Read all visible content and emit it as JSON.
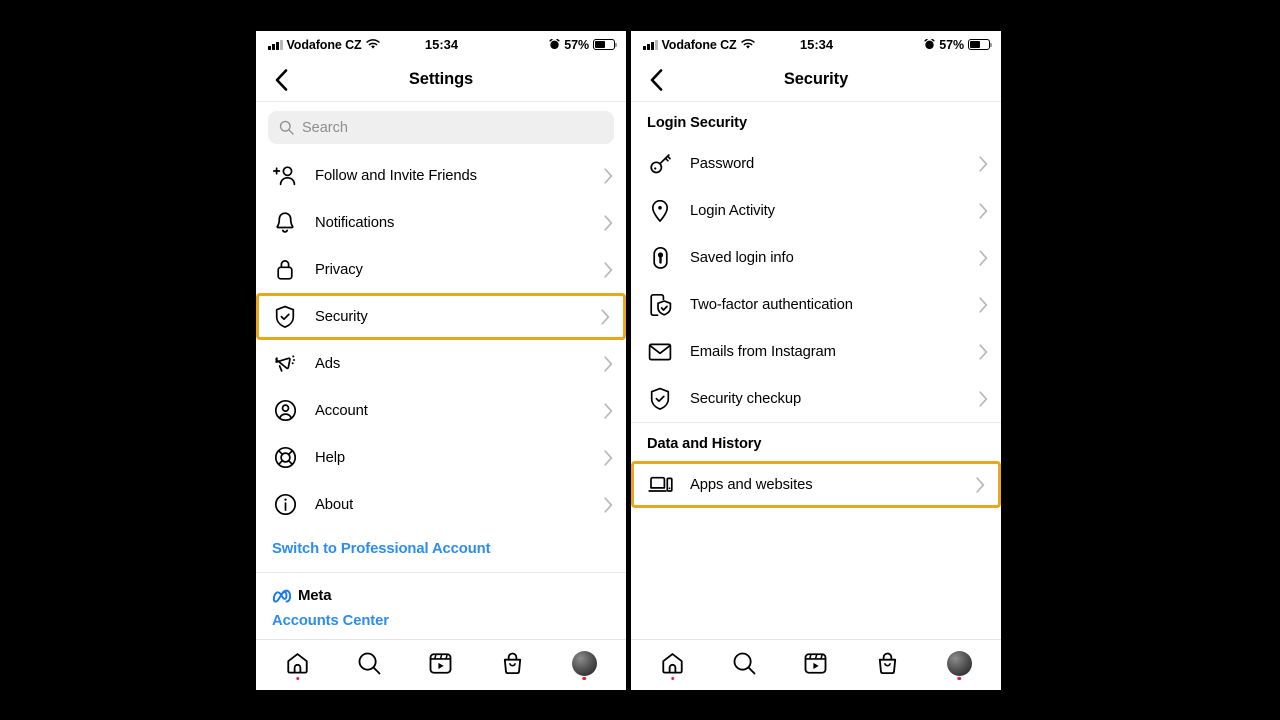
{
  "status_bar": {
    "carrier": "Vodafone CZ",
    "time": "15:34",
    "battery_percent": "57%",
    "signal_icon": "cellular-signal-icon",
    "wifi_icon": "wifi-icon",
    "alarm_icon": "alarm-clock-icon",
    "battery_icon": "battery-icon"
  },
  "left_panel": {
    "nav": {
      "back_icon": "back-chevron-icon",
      "title": "Settings"
    },
    "search": {
      "placeholder": "Search",
      "icon": "search-icon"
    },
    "items": [
      {
        "label": "Follow and Invite Friends",
        "icon": "add-person-icon"
      },
      {
        "label": "Notifications",
        "icon": "bell-icon"
      },
      {
        "label": "Privacy",
        "icon": "lock-icon"
      },
      {
        "label": "Security",
        "icon": "shield-check-icon",
        "highlighted": true
      },
      {
        "label": "Ads",
        "icon": "megaphone-icon"
      },
      {
        "label": "Account",
        "icon": "account-circle-icon"
      },
      {
        "label": "Help",
        "icon": "lifebuoy-icon"
      },
      {
        "label": "About",
        "icon": "info-circle-icon"
      }
    ],
    "switch_link": "Switch to Professional Account",
    "meta": {
      "logo_icon": "meta-infinity-icon",
      "wordmark": "Meta",
      "accounts_center": "Accounts Center"
    }
  },
  "right_panel": {
    "nav": {
      "back_icon": "back-chevron-icon",
      "title": "Security"
    },
    "sections": [
      {
        "title": "Login Security",
        "items": [
          {
            "label": "Password",
            "icon": "key-icon"
          },
          {
            "label": "Login Activity",
            "icon": "location-pin-icon"
          },
          {
            "label": "Saved login info",
            "icon": "keyhole-icon"
          },
          {
            "label": "Two-factor authentication",
            "icon": "phone-shield-icon"
          },
          {
            "label": "Emails from Instagram",
            "icon": "envelope-icon"
          },
          {
            "label": "Security checkup",
            "icon": "shield-check-icon"
          }
        ]
      },
      {
        "title": "Data and History",
        "items": [
          {
            "label": "Apps and websites",
            "icon": "laptop-phone-icon",
            "highlighted": true
          }
        ]
      }
    ]
  },
  "tab_bar": {
    "tabs": [
      {
        "name": "home",
        "icon": "home-icon",
        "badge_dot": true
      },
      {
        "name": "search",
        "icon": "search-icon",
        "badge_dot": false
      },
      {
        "name": "reels",
        "icon": "reels-icon",
        "badge_dot": false
      },
      {
        "name": "shop",
        "icon": "shop-bag-icon",
        "badge_dot": false
      },
      {
        "name": "profile",
        "icon": "profile-avatar-icon",
        "badge_dot": true
      }
    ]
  },
  "colors": {
    "highlight": "#e8a81e",
    "link": "#2d8cf0",
    "badge_dot": "#ed1f3d",
    "background": "#000000",
    "search_field": "#efefef"
  }
}
